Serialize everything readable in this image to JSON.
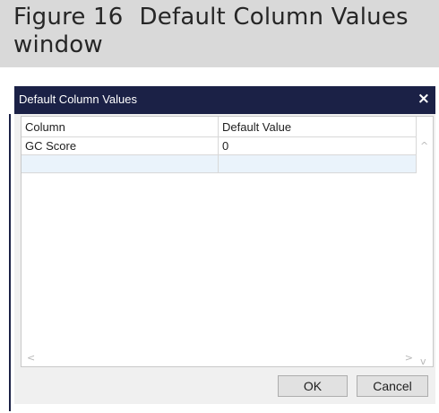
{
  "caption": {
    "number": "Figure 16",
    "title": "Default Column Values window"
  },
  "window": {
    "title": "Default Column Values",
    "close_glyph": "×"
  },
  "grid": {
    "columns": [
      "Column",
      "Default Value"
    ],
    "rows": [
      [
        "GC Score",
        "0"
      ],
      [
        "",
        ""
      ]
    ],
    "scroll_glyphs": {
      "up": "^",
      "down": "v",
      "left": "<",
      "right": ">"
    }
  },
  "buttons": {
    "ok": "OK",
    "cancel": "Cancel"
  },
  "colors": {
    "titlebar": "#1b2146",
    "caption_bg": "#d9d9d9",
    "selected_row": "#eaf3fb"
  }
}
